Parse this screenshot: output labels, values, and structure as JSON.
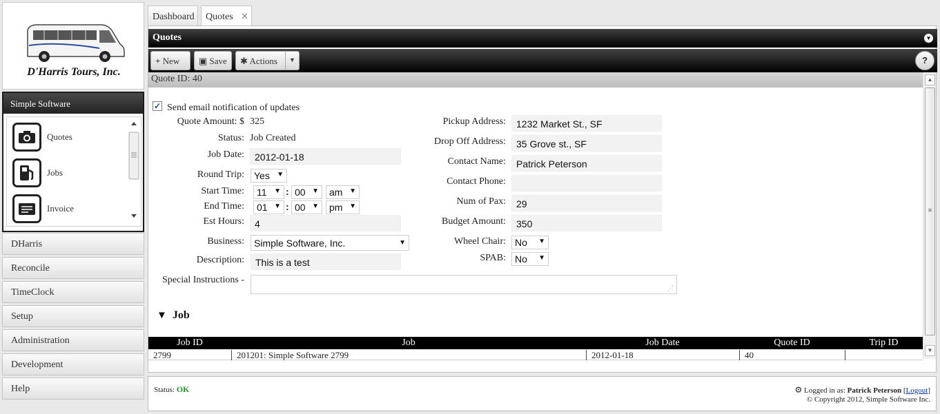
{
  "brand": {
    "company": "D'Harris Tours, Inc."
  },
  "sidebar": {
    "active_section": "Simple Software",
    "nav_items": [
      {
        "label": "Quotes",
        "icon": "camera-icon"
      },
      {
        "label": "Jobs",
        "icon": "fuel-pump-icon"
      },
      {
        "label": "Invoice",
        "icon": "invoice-icon"
      }
    ],
    "sections": [
      "DHarris",
      "Reconcile",
      "TimeClock",
      "Setup",
      "Administration",
      "Development",
      "Help"
    ]
  },
  "tabs": [
    {
      "label": "Dashboard",
      "active": false
    },
    {
      "label": "Quotes",
      "active": true,
      "closable": true
    }
  ],
  "panel": {
    "title": "Quotes"
  },
  "toolbar": {
    "new_label": "New",
    "save_label": "Save",
    "actions_label": "Actions",
    "help_label": "?"
  },
  "quote": {
    "id_label": "Quote ID: 40",
    "email_notify_label": "Send email notification of updates",
    "email_notify_checked": true,
    "labels": {
      "amount": "Quote Amount: $",
      "status": "Status:",
      "job_date": "Job Date:",
      "round_trip": "Round Trip:",
      "start_time": "Start Time:",
      "end_time": "End Time:",
      "est_hours": "Est Hours:",
      "business": "Business:",
      "description": "Description:",
      "special": "Special Instructions -",
      "pickup": "Pickup Address:",
      "dropoff": "Drop Off Address:",
      "contact_name": "Contact Name:",
      "contact_phone": "Contact Phone:",
      "num_pax": "Num of Pax:",
      "budget": "Budget Amount:",
      "wheelchair": "Wheel Chair:",
      "spab": "SPAB:"
    },
    "values": {
      "amount": "325",
      "status": "Job Created",
      "job_date": "2012-01-18",
      "round_trip": "Yes",
      "start_hour": "11",
      "start_min": "00",
      "start_ampm": "am",
      "end_hour": "01",
      "end_min": "00",
      "end_ampm": "pm",
      "est_hours": "4",
      "business": "Simple Software, Inc.",
      "description": "This is a test",
      "special": "",
      "pickup": "1232 Market St., SF",
      "dropoff": "35 Grove st., SF",
      "contact_name": "Patrick Peterson",
      "contact_phone": "",
      "num_pax": "29",
      "budget": "350",
      "wheelchair": "No",
      "spab": "No"
    }
  },
  "job_section": {
    "title": "Job",
    "columns": [
      "Job ID",
      "Job",
      "Job Date",
      "Quote ID",
      "Trip ID"
    ],
    "rows": [
      [
        "2799",
        "201201: Simple Software 2799",
        "2012-01-18",
        "40",
        ""
      ]
    ]
  },
  "status": {
    "label": "Status:",
    "value": "OK",
    "logged_in_prefix": "Logged in as:",
    "user": "Patrick Peterson",
    "logout": "Logout",
    "copyright": "© Copyright 2012, Simple Software Inc."
  }
}
